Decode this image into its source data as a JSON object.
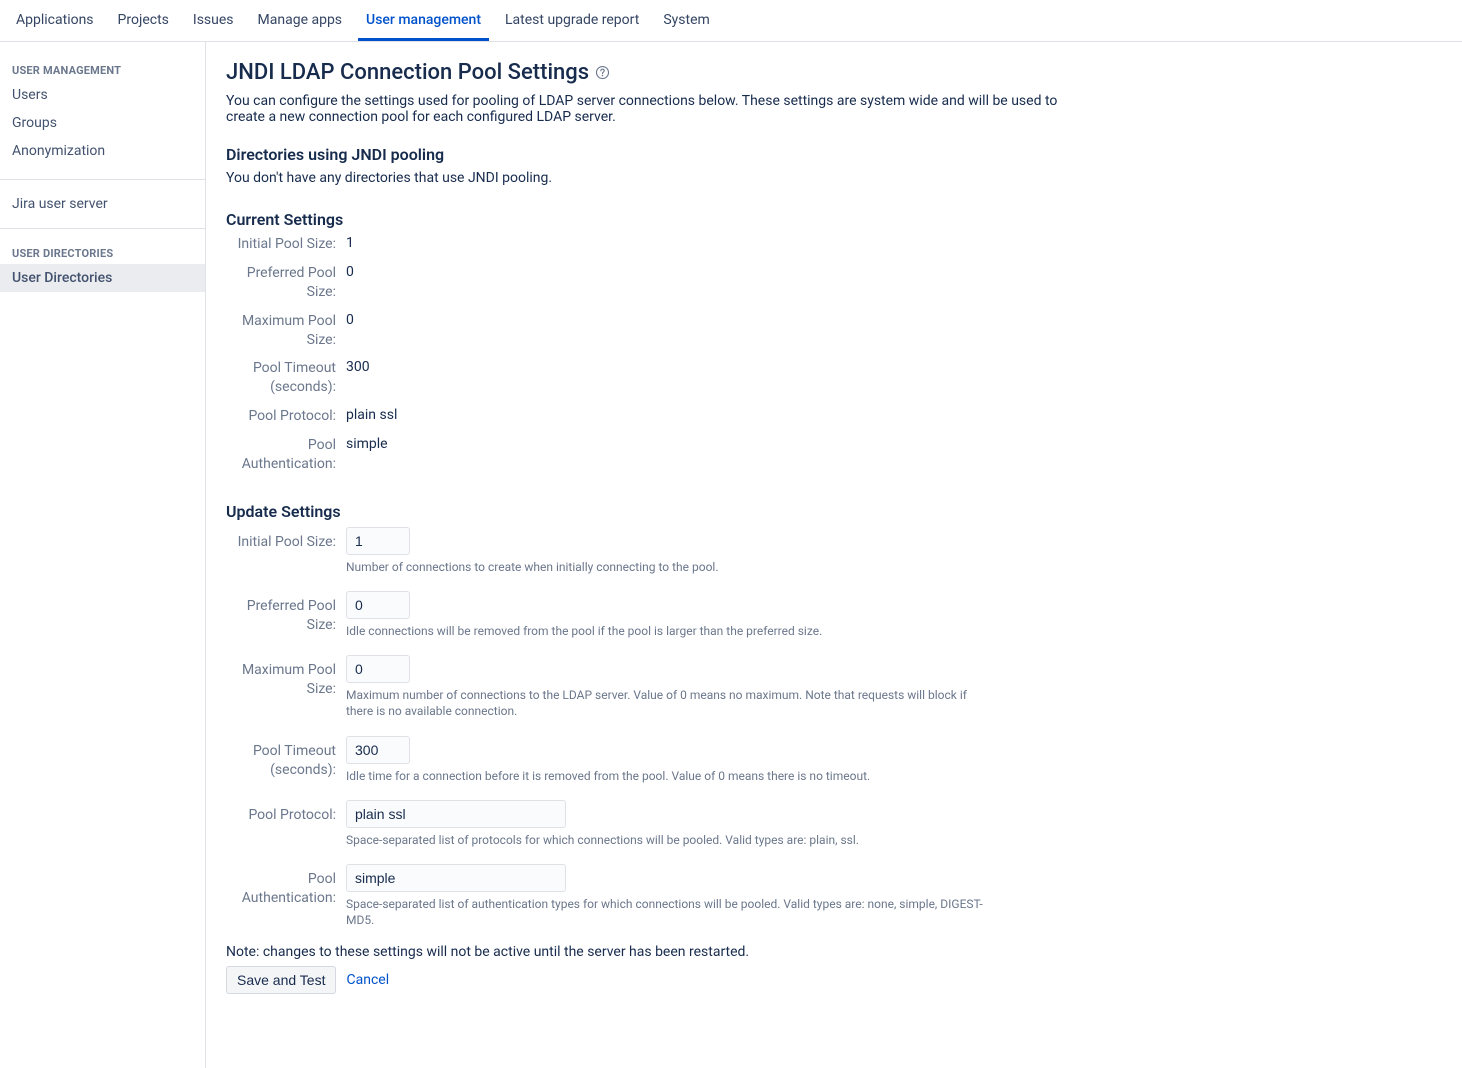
{
  "topTabs": {
    "items": [
      {
        "label": "Applications"
      },
      {
        "label": "Projects"
      },
      {
        "label": "Issues"
      },
      {
        "label": "Manage apps"
      },
      {
        "label": "User management"
      },
      {
        "label": "Latest upgrade report"
      },
      {
        "label": "System"
      }
    ],
    "activeIndex": 4
  },
  "sidebar": {
    "section1": {
      "heading": "USER MANAGEMENT",
      "items": [
        {
          "label": "Users"
        },
        {
          "label": "Groups"
        },
        {
          "label": "Anonymization"
        }
      ]
    },
    "jiraServer": {
      "label": "Jira user server"
    },
    "section2": {
      "heading": "USER DIRECTORIES",
      "items": [
        {
          "label": "User Directories",
          "selected": true
        }
      ]
    }
  },
  "page": {
    "title": "JNDI LDAP Connection Pool Settings",
    "intro": "You can configure the settings used for pooling of LDAP server connections below. These settings are system wide and will be used to create a new connection pool for each configured LDAP server.",
    "directoriesHeading": "Directories using JNDI pooling",
    "directoriesMsg": "You don't have any directories that use JNDI pooling.",
    "currentHeading": "Current Settings",
    "updateHeading": "Update Settings",
    "note": "Note: changes to these settings will not be active until the server has been restarted.",
    "saveLabel": "Save and Test",
    "cancelLabel": "Cancel"
  },
  "current": {
    "initialLabel": "Initial Pool Size:",
    "initialValue": "1",
    "preferredLabel": "Preferred Pool Size:",
    "preferredValue": "0",
    "maximumLabel": "Maximum Pool Size:",
    "maximumValue": "0",
    "timeoutLabel": "Pool Timeout (seconds):",
    "timeoutValue": "300",
    "protocolLabel": "Pool Protocol:",
    "protocolValue": "plain ssl",
    "authLabel": "Pool Authentication:",
    "authValue": "simple"
  },
  "form": {
    "initial": {
      "label": "Initial Pool Size:",
      "value": "1",
      "hint": "Number of connections to create when initially connecting to the pool."
    },
    "preferred": {
      "label": "Preferred Pool Size:",
      "value": "0",
      "hint": "Idle connections will be removed from the pool if the pool is larger than the preferred size."
    },
    "maximum": {
      "label": "Maximum Pool Size:",
      "value": "0",
      "hint": "Maximum number of connections to the LDAP server. Value of 0 means no maximum. Note that requests will block if there is no available connection."
    },
    "timeout": {
      "label": "Pool Timeout (seconds):",
      "value": "300",
      "hint": "Idle time for a connection before it is removed from the pool. Value of 0 means there is no timeout."
    },
    "protocol": {
      "label": "Pool Protocol:",
      "value": "plain ssl",
      "hint": "Space-separated list of protocols for which connections will be pooled. Valid types are: plain, ssl."
    },
    "auth": {
      "label": "Pool Authentication:",
      "value": "simple",
      "hint": "Space-separated list of authentication types for which connections will be pooled. Valid types are: none, simple, DIGEST-MD5."
    }
  }
}
